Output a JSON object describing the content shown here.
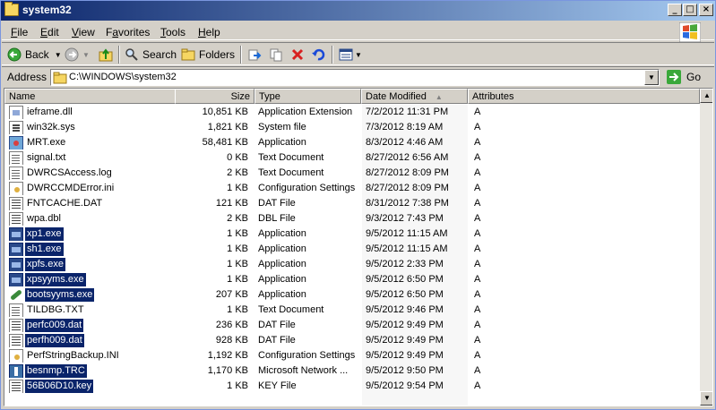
{
  "window": {
    "title": "system32"
  },
  "menu": [
    "File",
    "Edit",
    "View",
    "Favorites",
    "Tools",
    "Help"
  ],
  "menu_underline": [
    "F",
    "E",
    "V",
    "a",
    "T",
    "H"
  ],
  "toolbar": {
    "back_label": "Back",
    "search_label": "Search",
    "folders_label": "Folders"
  },
  "address": {
    "label": "Address",
    "value": "C:\\WINDOWS\\system32",
    "go_label": "Go"
  },
  "columns": {
    "name": "Name",
    "size": "Size",
    "type": "Type",
    "date": "Date Modified",
    "attributes": "Attributes"
  },
  "files": [
    {
      "name": "ieframe.dll",
      "size": "10,851 KB",
      "type": "Application Extension",
      "date": "7/2/2012 11:31 PM",
      "attr": "A",
      "icon": "dll-icon",
      "selected": false
    },
    {
      "name": "win32k.sys",
      "size": "1,821 KB",
      "type": "System file",
      "date": "7/3/2012 8:19 AM",
      "attr": "A",
      "icon": "sys-icon",
      "selected": false
    },
    {
      "name": "MRT.exe",
      "size": "58,481 KB",
      "type": "Application",
      "date": "8/3/2012 4:46 AM",
      "attr": "A",
      "icon": "mrt-icon",
      "selected": false
    },
    {
      "name": "signal.txt",
      "size": "0 KB",
      "type": "Text Document",
      "date": "8/27/2012 6:56 AM",
      "attr": "A",
      "icon": "txt-icon",
      "selected": false
    },
    {
      "name": "DWRCSAccess.log",
      "size": "2 KB",
      "type": "Text Document",
      "date": "8/27/2012 8:09 PM",
      "attr": "A",
      "icon": "txt-icon",
      "selected": false
    },
    {
      "name": "DWRCCMDError.ini",
      "size": "1 KB",
      "type": "Configuration Settings",
      "date": "8/27/2012 8:09 PM",
      "attr": "A",
      "icon": "ini-icon",
      "selected": false
    },
    {
      "name": "FNTCACHE.DAT",
      "size": "121 KB",
      "type": "DAT File",
      "date": "8/31/2012 7:38 PM",
      "attr": "A",
      "icon": "dat-icon",
      "selected": false
    },
    {
      "name": "wpa.dbl",
      "size": "2 KB",
      "type": "DBL File",
      "date": "9/3/2012 7:43 PM",
      "attr": "A",
      "icon": "dat-icon",
      "selected": false
    },
    {
      "name": "xp1.exe",
      "size": "1 KB",
      "type": "Application",
      "date": "9/5/2012 11:15 AM",
      "attr": "A",
      "icon": "exe-icon",
      "selected": true
    },
    {
      "name": "sh1.exe",
      "size": "1 KB",
      "type": "Application",
      "date": "9/5/2012 11:15 AM",
      "attr": "A",
      "icon": "exe-icon",
      "selected": true
    },
    {
      "name": "xpfs.exe",
      "size": "1 KB",
      "type": "Application",
      "date": "9/5/2012 2:33 PM",
      "attr": "A",
      "icon": "exe-icon",
      "selected": true
    },
    {
      "name": "xpsyyms.exe",
      "size": "1 KB",
      "type": "Application",
      "date": "9/5/2012 6:50 PM",
      "attr": "A",
      "icon": "exe-icon",
      "selected": true
    },
    {
      "name": "bootsyyms.exe",
      "size": "207 KB",
      "type": "Application",
      "date": "9/5/2012 6:50 PM",
      "attr": "A",
      "icon": "boot-icon",
      "selected": true
    },
    {
      "name": "TILDBG.TXT",
      "size": "1 KB",
      "type": "Text Document",
      "date": "9/5/2012 9:46 PM",
      "attr": "A",
      "icon": "txt-icon",
      "selected": false
    },
    {
      "name": "perfc009.dat",
      "size": "236 KB",
      "type": "DAT File",
      "date": "9/5/2012 9:49 PM",
      "attr": "A",
      "icon": "dat-icon",
      "selected": true
    },
    {
      "name": "perfh009.dat",
      "size": "928 KB",
      "type": "DAT File",
      "date": "9/5/2012 9:49 PM",
      "attr": "A",
      "icon": "dat-icon",
      "selected": true
    },
    {
      "name": "PerfStringBackup.INI",
      "size": "1,192 KB",
      "type": "Configuration Settings",
      "date": "9/5/2012 9:49 PM",
      "attr": "A",
      "icon": "ini-icon",
      "selected": false
    },
    {
      "name": "besnmp.TRC",
      "size": "1,170 KB",
      "type": "Microsoft Network ...",
      "date": "9/5/2012 9:50 PM",
      "attr": "A",
      "icon": "trc-icon",
      "selected": true
    },
    {
      "name": "56B06D10.key",
      "size": "1 KB",
      "type": "KEY File",
      "date": "9/5/2012 9:54 PM",
      "attr": "A",
      "icon": "key-icon",
      "selected": true
    }
  ],
  "colors": {
    "selection": "#0a246a",
    "face": "#d4d0c8",
    "title_start": "#0a246a"
  }
}
